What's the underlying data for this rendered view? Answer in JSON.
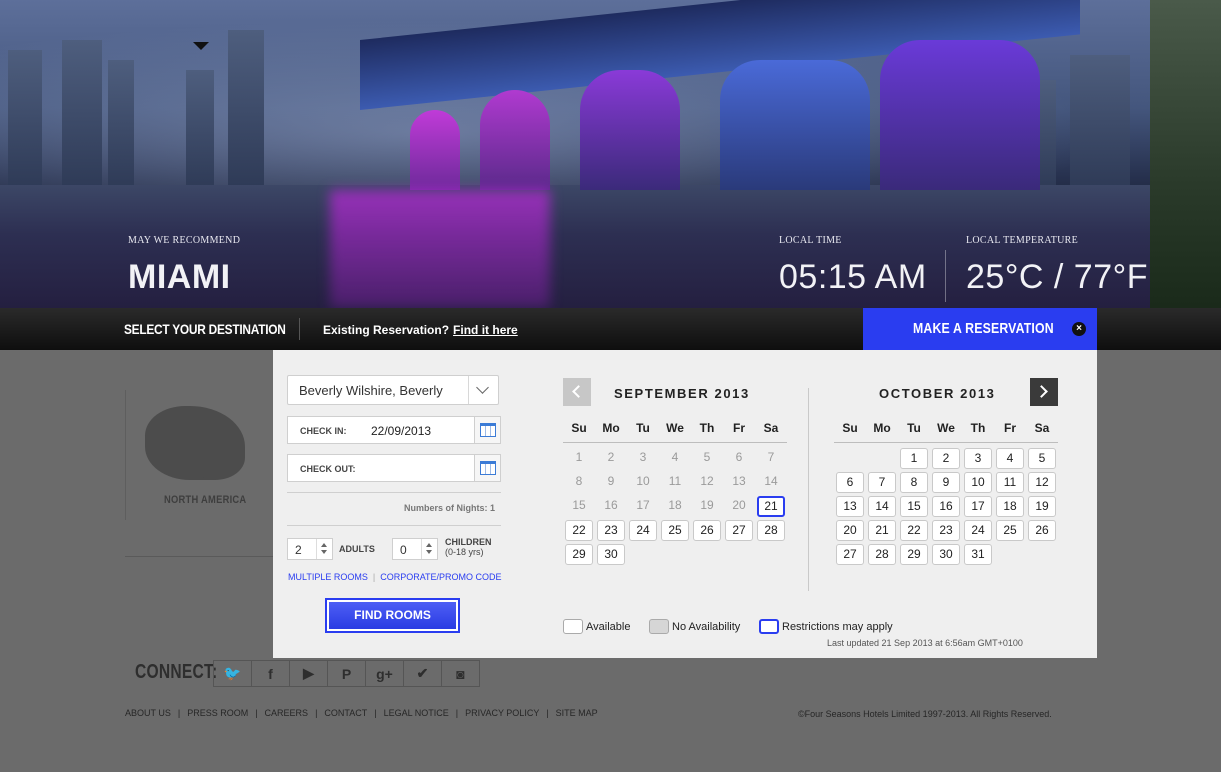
{
  "hero": {
    "recommend_label": "MAY WE RECOMMEND",
    "city": "MIAMI",
    "time_label": "LOCAL TIME",
    "time_value": "05:15 AM",
    "temp_label": "LOCAL TEMPERATURE",
    "temp_value": "25°C / 77°F"
  },
  "nav": {
    "select_destination": "SELECT YOUR DESTINATION",
    "existing_text": "Existing Reservation?",
    "find_it_link": "Find it here",
    "make_reservation": "MAKE A RESERVATION",
    "close_glyph": "×"
  },
  "background": {
    "region_label": "NORTH AMERICA",
    "connect_label": "CONNECT:",
    "social_icons": [
      "twitter-icon",
      "facebook-icon",
      "youtube-icon",
      "pinterest-icon",
      "google-plus-icon",
      "checkin-icon",
      "instagram-icon"
    ],
    "social_glyphs": [
      "🐦",
      "f",
      "▶",
      "P",
      "g+",
      "✔",
      "◙"
    ],
    "footer_links": [
      "ABOUT US",
      "PRESS ROOM",
      "CAREERS",
      "CONTACT",
      "LEGAL NOTICE",
      "PRIVACY POLICY",
      "SITE MAP"
    ],
    "copyright": "©Four Seasons Hotels Limited 1997-2013. All Rights Reserved."
  },
  "booking": {
    "destination_value": "Beverly Wilshire, Beverly",
    "check_in_label": "CHECK IN:",
    "check_in_value": "22/09/2013",
    "check_out_label": "CHECK OUT:",
    "check_out_value": "",
    "nights_text": "Numbers of Nights: 1",
    "adults_value": "2",
    "adults_label": "ADULTS",
    "children_value": "0",
    "children_label": "CHILDREN",
    "children_sub": "(0-18 yrs)",
    "multiple_rooms": "MULTIPLE ROOMS",
    "corporate_code": "CORPORATE/PROMO CODE",
    "find_rooms": "FIND ROOMS"
  },
  "calendar": {
    "weekdays": [
      "Su",
      "Mo",
      "Tu",
      "We",
      "Th",
      "Fr",
      "Sa"
    ],
    "months": [
      {
        "title": "SEPTEMBER 2013",
        "first_weekday": 0,
        "days": 30,
        "unavailable_through": 20,
        "restricted": [
          21
        ]
      },
      {
        "title": "OCTOBER 2013",
        "first_weekday": 2,
        "days": 31,
        "unavailable_through": 0,
        "restricted": []
      }
    ],
    "legend_available": "Available",
    "legend_no_availability": "No Availability",
    "legend_restrictions": "Restrictions may apply",
    "last_updated": "Last updated 21 Sep 2013 at 6:56am GMT+0100"
  },
  "colors": {
    "accent_blue": "#2a3df0",
    "panel_bg": "#efefef",
    "overlay_gray": "#6b6b6b"
  }
}
